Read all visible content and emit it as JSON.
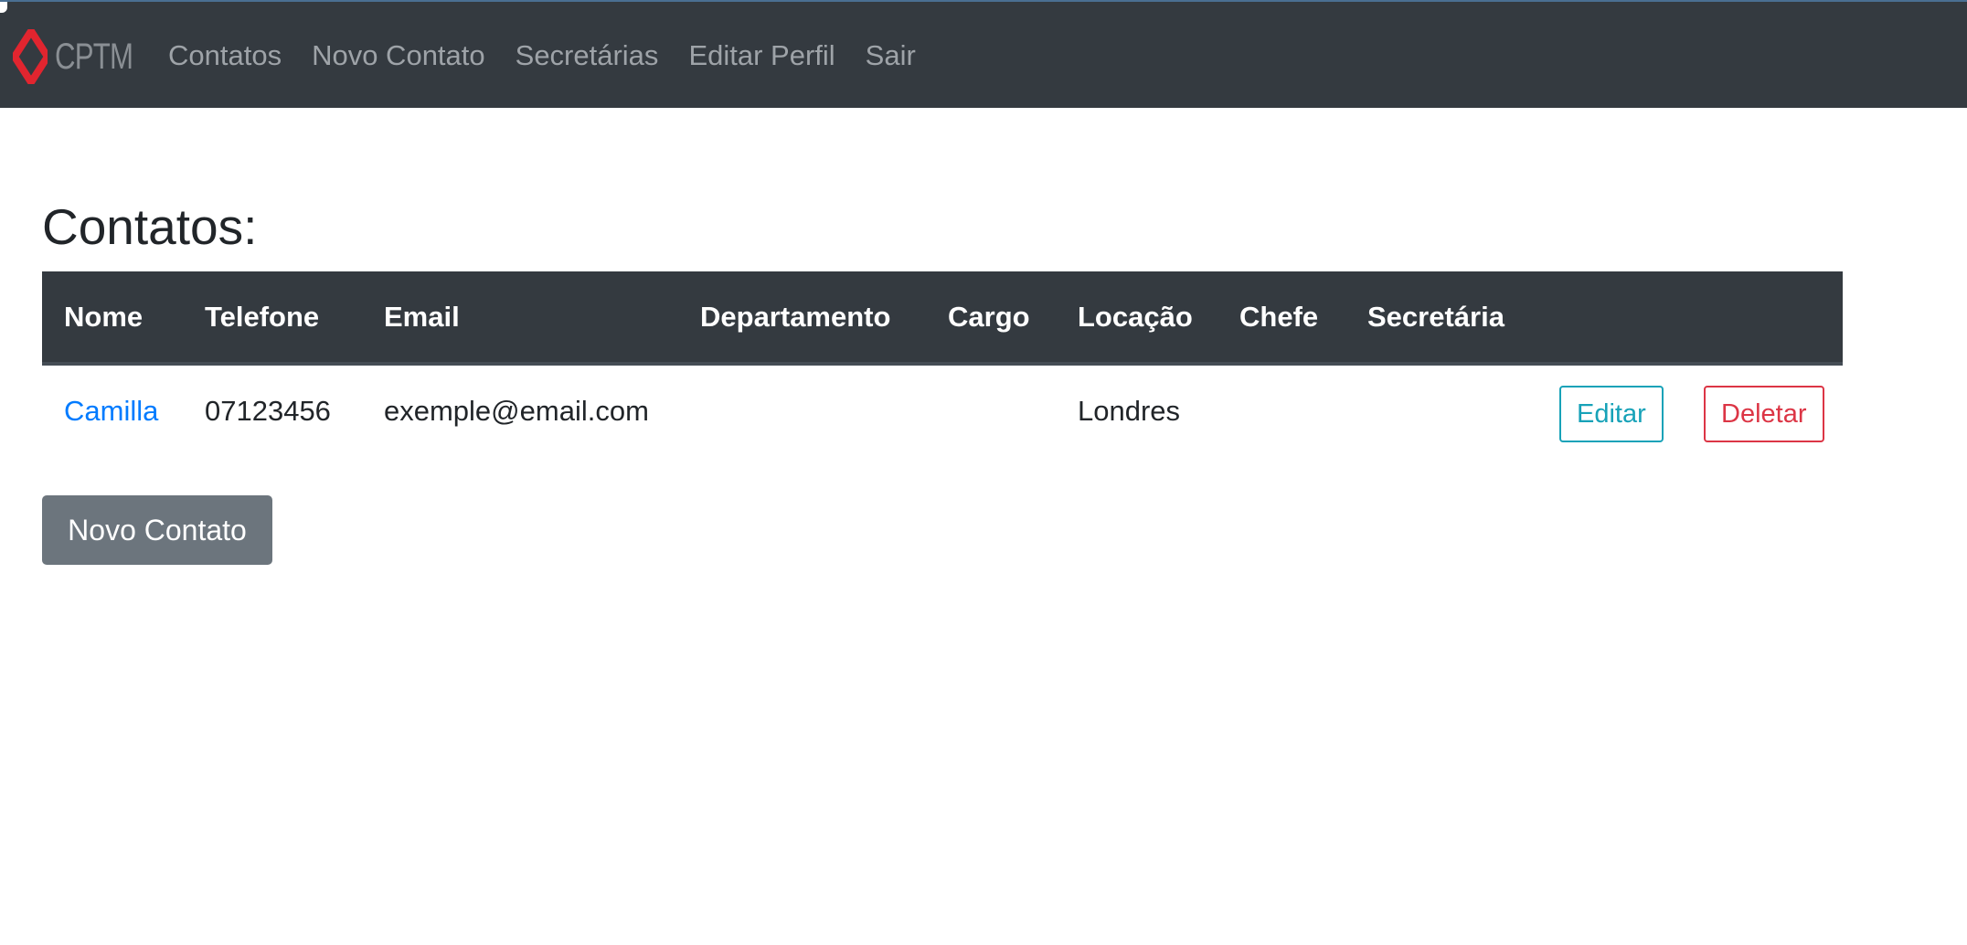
{
  "brand": {
    "logo_text": "CPTM",
    "accent_color": "#e1252f"
  },
  "nav": {
    "items": [
      {
        "label": "Contatos"
      },
      {
        "label": "Novo Contato"
      },
      {
        "label": "Secretárias"
      },
      {
        "label": "Editar Perfil"
      },
      {
        "label": "Sair"
      }
    ]
  },
  "page": {
    "title": "Contatos:"
  },
  "table": {
    "columns": [
      "Nome",
      "Telefone",
      "Email",
      "Departamento",
      "Cargo",
      "Locação",
      "Chefe",
      "Secretária"
    ],
    "rows": [
      {
        "nome": "Camilla",
        "telefone": "07123456",
        "email": "exemple@email.com",
        "departamento": "",
        "cargo": "",
        "locacao": "Londres",
        "chefe": "",
        "secretaria": "",
        "edit_label": "Editar",
        "delete_label": "Deletar"
      }
    ]
  },
  "actions": {
    "new_contact_label": "Novo Contato"
  },
  "colors": {
    "navbar_bg": "#343a40",
    "link": "#007bff",
    "edit_outline": "#17a2b8",
    "delete_outline": "#dc3545",
    "secondary_button": "#6c757d"
  }
}
